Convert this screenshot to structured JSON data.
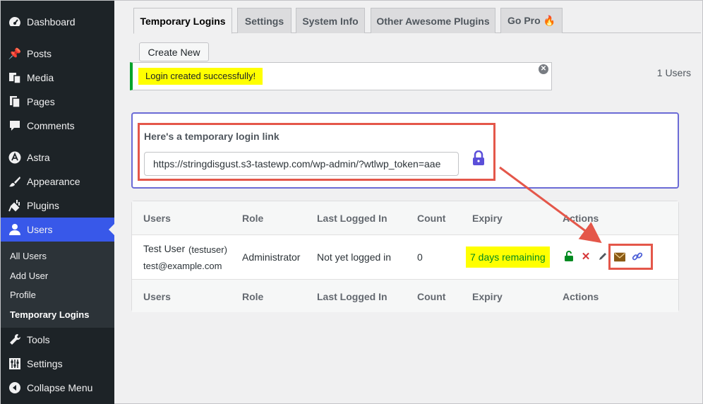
{
  "sidebar": {
    "items": [
      {
        "label": "Dashboard",
        "icon": "dashboard-icon"
      },
      {
        "label": "Posts",
        "icon": "pin-icon"
      },
      {
        "label": "Media",
        "icon": "media-icon"
      },
      {
        "label": "Pages",
        "icon": "pages-icon"
      },
      {
        "label": "Comments",
        "icon": "comments-icon"
      },
      {
        "label": "Astra",
        "icon": "astra-icon"
      },
      {
        "label": "Appearance",
        "icon": "appearance-icon"
      },
      {
        "label": "Plugins",
        "icon": "plugins-icon"
      },
      {
        "label": "Users",
        "icon": "users-icon"
      },
      {
        "label": "Tools",
        "icon": "tools-icon"
      },
      {
        "label": "Settings",
        "icon": "settings-icon"
      },
      {
        "label": "Collapse Menu",
        "icon": "collapse-icon"
      }
    ],
    "submenu": [
      "All Users",
      "Add User",
      "Profile",
      "Temporary Logins"
    ]
  },
  "tabs": [
    "Temporary Logins",
    "Settings",
    "System Info",
    "Other Awesome Plugins",
    "Go Pro 🔥"
  ],
  "create_button": "Create New",
  "notice": {
    "text": "Login created successfully!",
    "dismiss": "✕"
  },
  "users_count": "1 Users",
  "link_box": {
    "label": "Here's a temporary login link",
    "url": "https://stringdisgust.s3-tastewp.com/wp-admin/?wtlwp_token=aae"
  },
  "table": {
    "headers": [
      "Users",
      "Role",
      "Last Logged In",
      "Count",
      "Expiry",
      "Actions"
    ],
    "row": {
      "name": "Test User",
      "username": "(testuser)",
      "email": "test@example.com",
      "role": "Administrator",
      "last_login": "Not yet logged in",
      "count": "0",
      "expiry": "7 days remaining"
    }
  },
  "colors": {
    "accent": "#3858e9",
    "sidebar": "#1d2327",
    "highlight_border": "#e4574a",
    "notice_success": "#00a32a"
  }
}
